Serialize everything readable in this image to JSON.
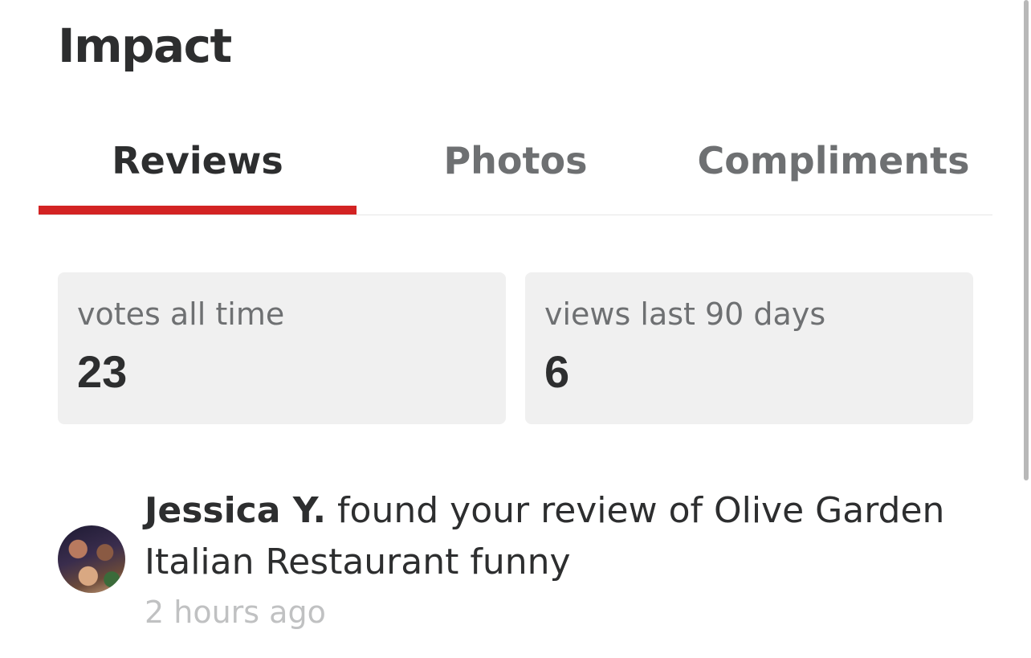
{
  "header": {
    "title": "Impact"
  },
  "tabs": [
    {
      "label": "Reviews",
      "active": true
    },
    {
      "label": "Photos",
      "active": false
    },
    {
      "label": "Compliments",
      "active": false
    }
  ],
  "stats": [
    {
      "label": "votes all time",
      "value": "23"
    },
    {
      "label": "views last 90 days",
      "value": "6"
    }
  ],
  "activity": [
    {
      "user": "Jessica Y.",
      "message": " found your review of Olive Garden Italian Restaurant funny",
      "time": "2 hours ago"
    }
  ],
  "colors": {
    "accent": "#d32323",
    "card_background": "#f0f0f0",
    "text_primary": "#2d2e2f",
    "text_secondary": "#6e7072",
    "text_muted": "#c0c1c2"
  }
}
